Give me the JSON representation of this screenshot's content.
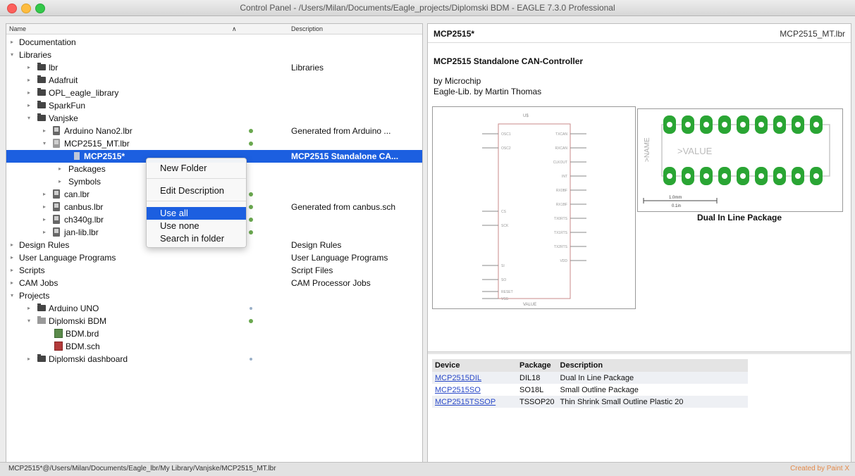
{
  "window": {
    "title": "Control Panel - /Users/Milan/Documents/Eagle_projects/Diplomski BDM - EAGLE 7.3.0 Professional"
  },
  "tree": {
    "columns": {
      "name": "Name",
      "sort": "∧",
      "description": "Description"
    },
    "rows": [
      {
        "arrow": "▸",
        "label": "Documentation",
        "desc": ""
      },
      {
        "arrow": "▾",
        "label": "Libraries",
        "desc": ""
      },
      {
        "arrow": "▸",
        "label": "lbr",
        "desc": "Libraries"
      },
      {
        "arrow": "▸",
        "label": "Adafruit",
        "desc": ""
      },
      {
        "arrow": "▸",
        "label": "OPL_eagle_library",
        "desc": ""
      },
      {
        "arrow": "▸",
        "label": "SparkFun",
        "desc": ""
      },
      {
        "arrow": "▾",
        "label": "Vanjske",
        "desc": ""
      },
      {
        "arrow": "▸",
        "label": "Arduino Nano2.lbr",
        "desc": "Generated from Arduino ..."
      },
      {
        "arrow": "▾",
        "label": "MCP2515_MT.lbr",
        "desc": ""
      },
      {
        "arrow": "",
        "label": "MCP2515*",
        "desc": "MCP2515 Standalone CA..."
      },
      {
        "arrow": "▸",
        "label": "Packages",
        "desc": ""
      },
      {
        "arrow": "▸",
        "label": "Symbols",
        "desc": ""
      },
      {
        "arrow": "▸",
        "label": "can.lbr",
        "desc": ""
      },
      {
        "arrow": "▸",
        "label": "canbus.lbr",
        "desc": "Generated from canbus.sch"
      },
      {
        "arrow": "▸",
        "label": "ch340g.lbr",
        "desc": ""
      },
      {
        "arrow": "▸",
        "label": "jan-lib.lbr",
        "desc": ""
      },
      {
        "arrow": "▸",
        "label": "Design Rules",
        "desc": "Design Rules"
      },
      {
        "arrow": "▸",
        "label": "User Language Programs",
        "desc": "User Language Programs"
      },
      {
        "arrow": "▸",
        "label": "Scripts",
        "desc": "Script Files"
      },
      {
        "arrow": "▸",
        "label": "CAM Jobs",
        "desc": "CAM Processor Jobs"
      },
      {
        "arrow": "▾",
        "label": "Projects",
        "desc": ""
      },
      {
        "arrow": "▸",
        "label": "Arduino UNO",
        "desc": ""
      },
      {
        "arrow": "▾",
        "label": "Diplomski BDM",
        "desc": ""
      },
      {
        "arrow": "",
        "label": "BDM.brd",
        "desc": ""
      },
      {
        "arrow": "",
        "label": "BDM.sch",
        "desc": ""
      },
      {
        "arrow": "▸",
        "label": "Diplomski dashboard",
        "desc": ""
      }
    ]
  },
  "context_menu": {
    "items": [
      "New Folder",
      "Edit Description",
      "Use all",
      "Use none",
      "Search in folder"
    ]
  },
  "detail": {
    "device_name": "MCP2515*",
    "library_file": "MCP2515_MT.lbr",
    "title": "MCP2515 Standalone CAN-Controller",
    "by_line": "by Microchip",
    "author_line": "Eagle-Lib. by Martin Thomas",
    "symbol": {
      "top_label": "U$",
      "bottom_label": "VALUE",
      "left_pins": [
        "OSC1",
        "OSC2",
        "CS",
        "SCK",
        "SI",
        "SO",
        "RESET",
        "VSS"
      ],
      "right_pins": [
        "TXCAN",
        "RXCAN",
        "CLKOUT",
        "INT",
        "RX0BF",
        "RX1BF",
        "TX0RTS",
        "TX1RTS",
        "TX2RTS",
        "VDD"
      ]
    },
    "package": {
      "name_text": ">NAME",
      "value_text": ">VALUE",
      "dim_1": "1.0mm",
      "dim_2": "0.1in",
      "label": "Dual In Line Package"
    },
    "table": {
      "headers": [
        "Device",
        "Package",
        "Description"
      ],
      "rows": [
        [
          "MCP2515DIL",
          "DIL18",
          "Dual In Line Package"
        ],
        [
          "MCP2515SO",
          "SO18L",
          "Small Outline Package"
        ],
        [
          "MCP2515TSSOP",
          "TSSOP20",
          "Thin Shrink Small Outline Plastic 20"
        ]
      ]
    }
  },
  "status": {
    "path": "MCP2515*@/Users/Milan/Documents/Eagle_lbr/My Library/Vanjske/MCP2515_MT.lbr",
    "watermark": "Created by Paint X"
  },
  "colors": {
    "selection": "#1c5fe0",
    "pad": "#2aa534",
    "link": "#2848c8"
  }
}
